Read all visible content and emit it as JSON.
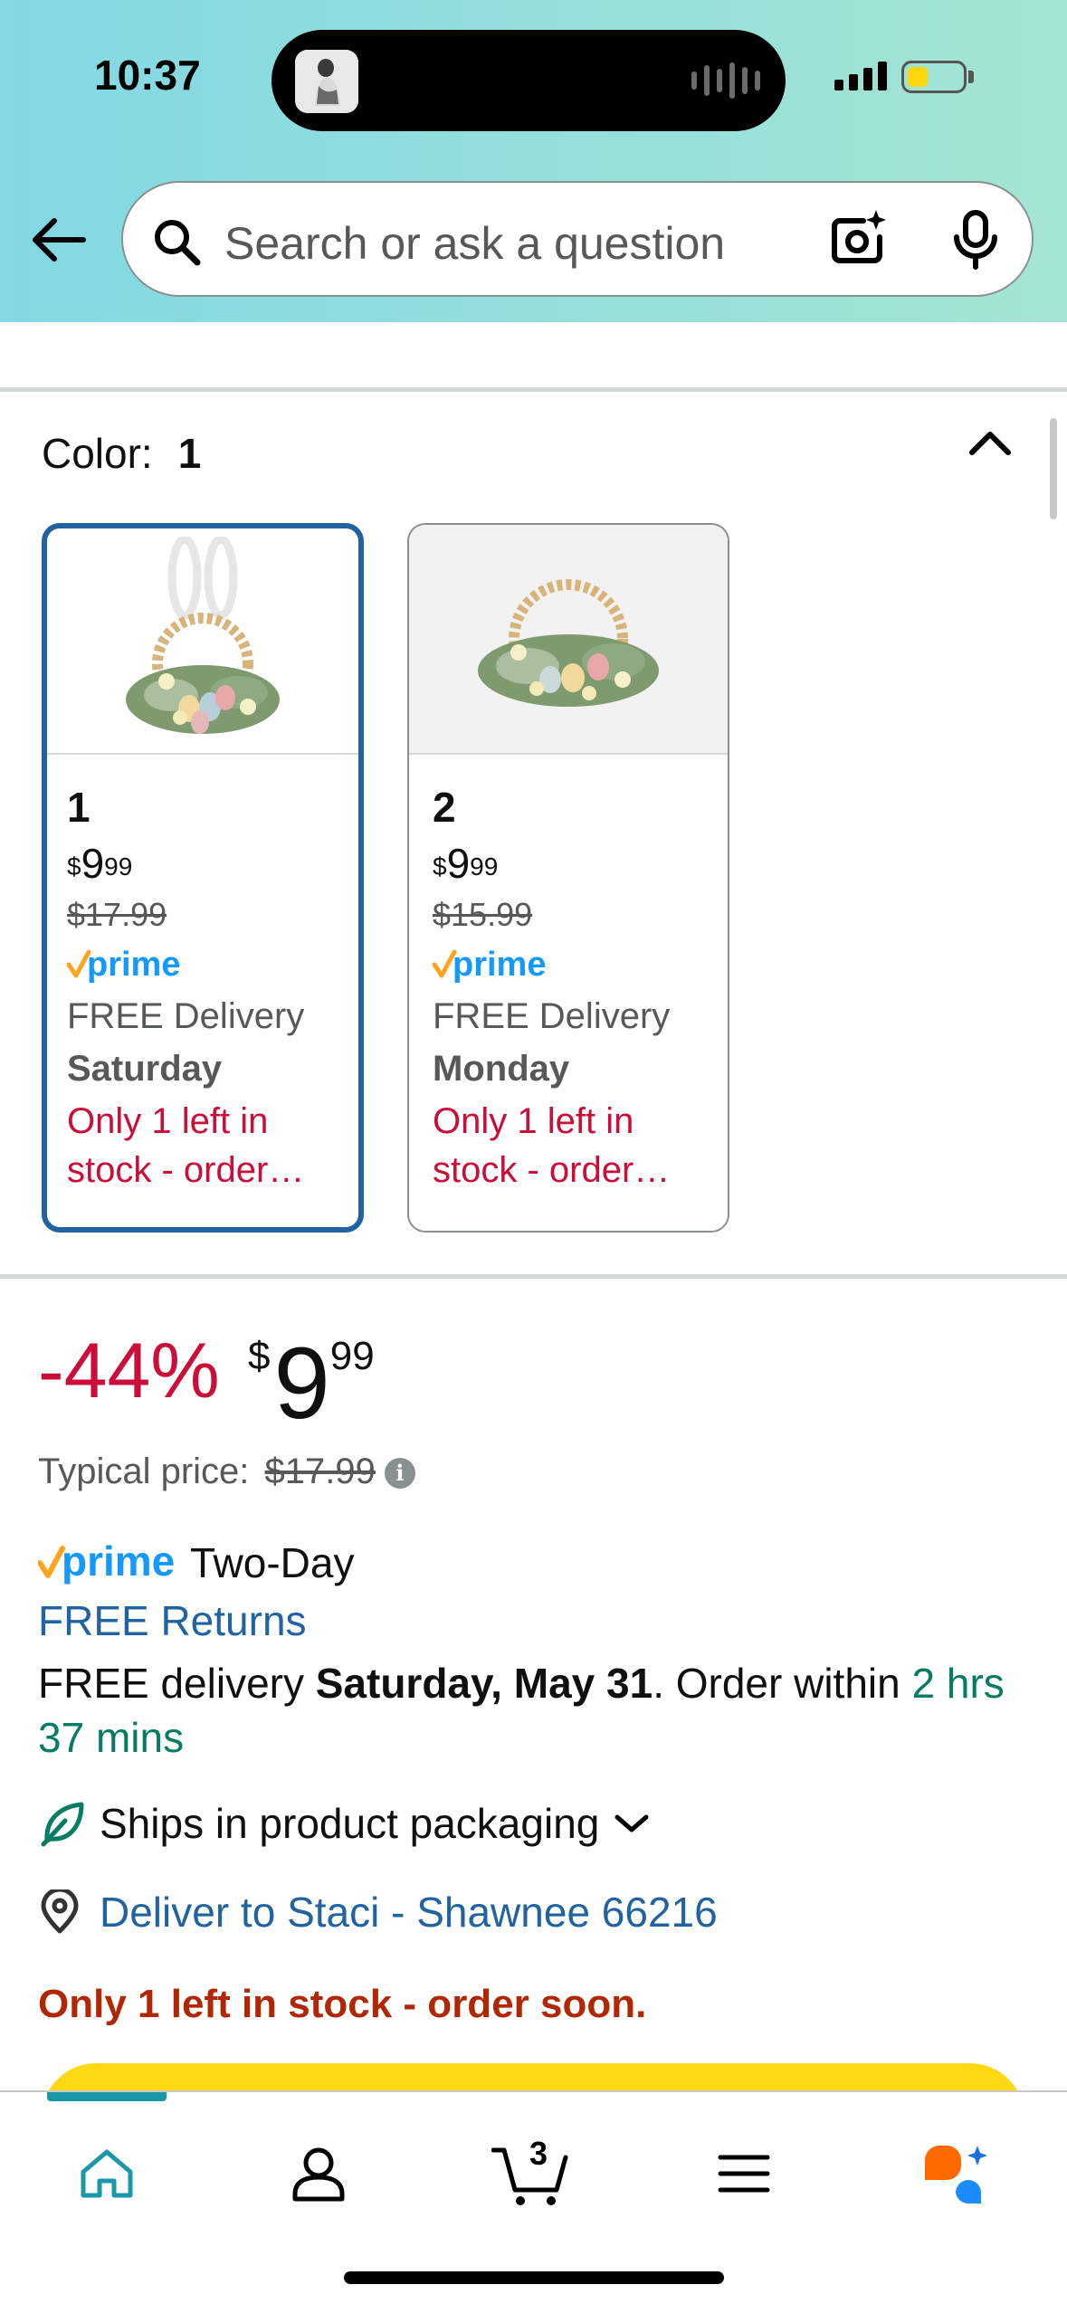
{
  "status_bar": {
    "time": "10:37"
  },
  "search": {
    "placeholder": "Search or ask a question"
  },
  "variation": {
    "label": "Color:",
    "selected": "1",
    "options": [
      {
        "name": "1",
        "currency": "$",
        "price_whole": "9",
        "price_cents": "99",
        "list_price": "$17.99",
        "prime": "prime",
        "delivery_label": "FREE Delivery",
        "delivery_day": "Saturday",
        "stock": "Only 1 left in stock - order…"
      },
      {
        "name": "2",
        "currency": "$",
        "price_whole": "9",
        "price_cents": "99",
        "list_price": "$15.99",
        "prime": "prime",
        "delivery_label": "FREE Delivery",
        "delivery_day": "Monday",
        "stock": "Only 1 left in stock - order…"
      }
    ]
  },
  "price": {
    "discount": "-44%",
    "currency": "$",
    "whole": "9",
    "cents": "99",
    "typical_label": "Typical price:",
    "typical_value": "$17.99"
  },
  "shipping": {
    "prime_label": "prime",
    "prime_speed": "Two-Day",
    "free_returns": "FREE Returns",
    "delivery_prefix": "FREE delivery",
    "delivery_date": "Saturday, May 31",
    "order_within": ". Order within",
    "countdown": "2 hrs 37 mins",
    "packaging": "Ships in product packaging",
    "deliver_to": "Deliver to Staci - Shawnee 66216",
    "stock_warning": "Only 1 left in stock - order soon."
  },
  "nav": {
    "cart_count": "3"
  },
  "colors": {
    "accent": "#2162a1",
    "deal_red": "#cc0c39",
    "prime_blue": "#1399ff",
    "prime_check": "#ffa41c",
    "buy_yellow": "#ffd814"
  }
}
